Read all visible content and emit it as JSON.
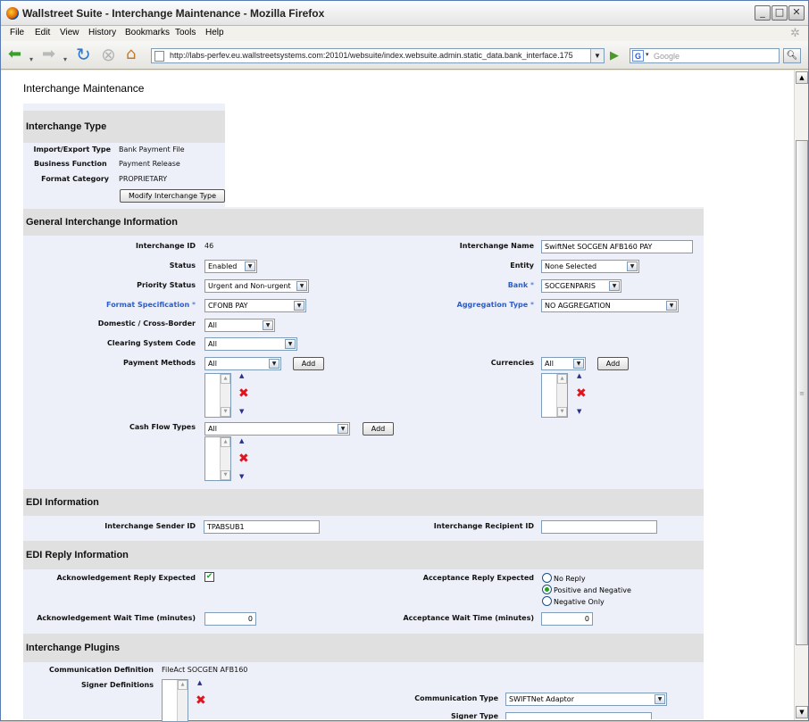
{
  "window": {
    "title": "Wallstreet Suite - Interchange Maintenance - Mozilla Firefox"
  },
  "menu": [
    "File",
    "Edit",
    "View",
    "History",
    "Bookmarks",
    "Tools",
    "Help"
  ],
  "url": "http://labs-perfev.eu.wallstreetsystems.com:20101/websuite/index.websuite.admin.static_data.bank_interface.175",
  "search": {
    "placeholder": "Google"
  },
  "page": {
    "title": "Interchange Maintenance"
  },
  "interchange_type": {
    "header": "Interchange Type",
    "import_export_label": "Import/Export Type",
    "import_export_value": "Bank Payment File",
    "business_function_label": "Business Function",
    "business_function_value": "Payment Release",
    "format_category_label": "Format Category",
    "format_category_value": "PROPRIETARY",
    "modify_button": "Modify Interchange Type"
  },
  "general": {
    "header": "General Interchange Information",
    "interchange_id_label": "Interchange ID",
    "interchange_id_value": "46",
    "interchange_name_label": "Interchange Name",
    "interchange_name_value": "SwiftNet SOCGEN AFB160 PAY",
    "status_label": "Status",
    "status_value": "Enabled",
    "entity_label": "Entity",
    "entity_value": "None Selected",
    "priority_label": "Priority Status",
    "priority_value": "Urgent and Non-urgent",
    "bank_label": "Bank",
    "bank_value": "SOCGENPARIS",
    "format_spec_label": "Format Specification",
    "format_spec_value": "CFONB PAY",
    "aggregation_label": "Aggregation Type",
    "aggregation_value": "NO AGGREGATION",
    "domestic_label": "Domestic / Cross-Border",
    "domestic_value": "All",
    "clearing_label": "Clearing System Code",
    "clearing_value": "All",
    "payment_methods_label": "Payment Methods",
    "payment_methods_value": "All",
    "currencies_label": "Currencies",
    "currencies_value": "All",
    "cash_flow_label": "Cash Flow Types",
    "cash_flow_value": "All",
    "add_label": "Add",
    "required_mark": "*"
  },
  "edi": {
    "header": "EDI Information",
    "sender_label": "Interchange Sender ID",
    "sender_value": "TPABSUB1",
    "recipient_label": "Interchange Recipient ID",
    "recipient_value": ""
  },
  "edi_reply": {
    "header": "EDI Reply Information",
    "ack_expected_label": "Acknowledgement Reply Expected",
    "acceptance_expected_label": "Acceptance Reply Expected",
    "options": [
      "No Reply",
      "Positive and Negative",
      "Negative Only"
    ],
    "ack_wait_label": "Acknowledgement Wait Time (minutes)",
    "ack_wait_value": "0",
    "accept_wait_label": "Acceptance Wait Time (minutes)",
    "accept_wait_value": "0"
  },
  "plugins": {
    "header": "Interchange Plugins",
    "comm_def_label": "Communication Definition",
    "comm_def_value": "FileAct SOCGEN AFB160",
    "signer_label": "Signer Definitions",
    "comm_type_label": "Communication Type",
    "comm_type_value": "SWIFTNet Adaptor",
    "signer_type_label": "Signer Type"
  }
}
